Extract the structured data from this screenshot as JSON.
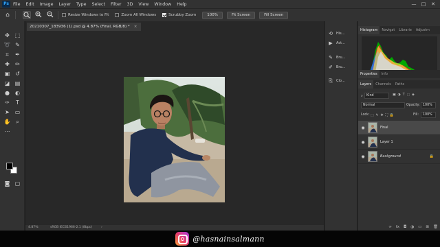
{
  "menubar": {
    "logo": "Ps",
    "items": [
      "File",
      "Edit",
      "Image",
      "Layer",
      "Type",
      "Select",
      "Filter",
      "3D",
      "View",
      "Window",
      "Help"
    ],
    "minimize": "—",
    "maximize": "□",
    "close": "✕"
  },
  "options": {
    "resize_windows": "Resize Windows to Fit",
    "zoom_all": "Zoom All Windows",
    "scrubby_zoom": "Scrubby Zoom",
    "zoom_value": "100%",
    "fit_screen": "Fit Screen",
    "fill_screen": "Fill Screen"
  },
  "document": {
    "tab_title": "20210307_183936 (1).psd @ 4.87% (Final, RGB/8) *",
    "close": "×",
    "status_zoom": "4.87%",
    "status_profile": "sRGB IEC61966-2.1 (8bpc)",
    "status_arrow": "›"
  },
  "side_panel": {
    "items": [
      {
        "label": "His...",
        "icon": "history-icon"
      },
      {
        "label": "Act...",
        "icon": "actions-icon"
      },
      {
        "label": "Bru...",
        "icon": "brush-icon"
      },
      {
        "label": "Bru...",
        "icon": "brush-settings-icon"
      },
      {
        "label": "Clo...",
        "icon": "clone-source-icon"
      }
    ]
  },
  "histogram_panel": {
    "tabs": [
      "Histogram",
      "Navigat",
      "Librarie",
      "Adjustm"
    ]
  },
  "properties_panel": {
    "tabs": [
      "Properties",
      "Info"
    ]
  },
  "layers_panel": {
    "tabs": [
      "Layers",
      "Channels",
      "Paths"
    ],
    "filter_kind": "Kind",
    "blend_mode": "Normal",
    "opacity_label": "Opacity:",
    "opacity_value": "100%",
    "lock_label": "Lock:",
    "fill_label": "Fill:",
    "fill_value": "100%",
    "layers": [
      {
        "name": "Final",
        "italic": false,
        "selected": true
      },
      {
        "name": "Layer 1",
        "italic": false,
        "selected": false
      },
      {
        "name": "Background",
        "italic": true,
        "selected": false
      }
    ],
    "footer_icons": [
      "link",
      "fx",
      "mask",
      "adjust",
      "folder",
      "new",
      "trash"
    ]
  },
  "banner": {
    "handle": "@hasnainsalmann"
  },
  "colors": {
    "menu_bg": "#323232",
    "canvas_bg": "#282828",
    "accent_ps": "#31a8ff",
    "selected_layer": "#494949"
  }
}
